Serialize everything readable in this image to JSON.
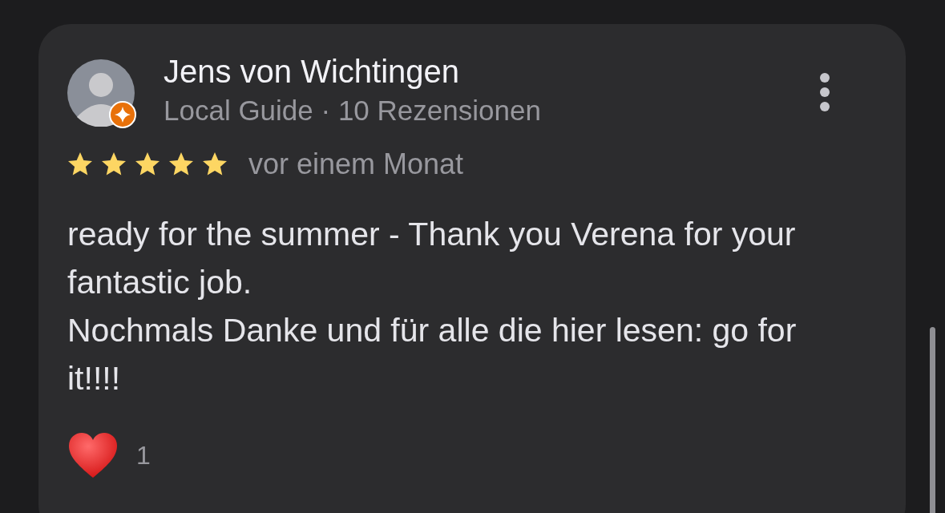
{
  "review": {
    "author": "Jens von Wichtingen",
    "meta": "Local Guide · 10 Rezensionen",
    "local_guide": true,
    "stars": 5,
    "time": "vor einem Monat",
    "paragraphs": [
      "ready for the summer - Thank you Verena for your fantastic job.",
      "Nochmals Danke und für alle die hier lesen: go for it!!!!"
    ],
    "reaction_count": "1"
  }
}
